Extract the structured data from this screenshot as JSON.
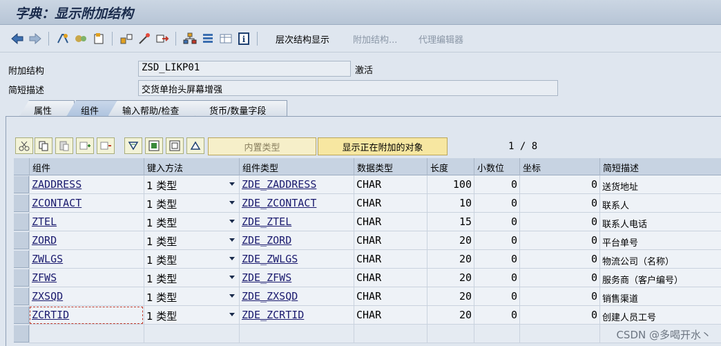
{
  "window": {
    "title": "字典：显示附加结构"
  },
  "toolbar": {
    "hierarchy_label": "层次结构显示",
    "append_label": "附加结构...",
    "proxy_label": "代理编辑器"
  },
  "form": {
    "append_structure_label": "附加结构",
    "append_structure_value": "ZSD_LIKP01",
    "status": "激活",
    "short_desc_label": "简短描述",
    "short_desc_value": "交货单抬头屏幕增强"
  },
  "tabs": [
    {
      "label": "属性"
    },
    {
      "label": "组件"
    },
    {
      "label": "输入帮助/检查"
    },
    {
      "label": "货币/数量字段"
    }
  ],
  "table_toolbar": {
    "builtin_type_label": "内置类型",
    "show_attached_label": "显示正在附加的对象",
    "page": "1 / 8"
  },
  "grid": {
    "headers": [
      "组件",
      "键入方法",
      "组件类型",
      "数据类型",
      "长度",
      "小数位",
      "坐标",
      "简短描述"
    ],
    "rows": [
      {
        "component": "ZADDRESS",
        "method": "1 类型",
        "type": "ZDE_ZADDRESS",
        "datatype": "CHAR",
        "length": "100",
        "decimals": "0",
        "coord": "0",
        "desc": "送货地址"
      },
      {
        "component": "ZCONTACT",
        "method": "1 类型",
        "type": "ZDE_ZCONTACT",
        "datatype": "CHAR",
        "length": "10",
        "decimals": "0",
        "coord": "0",
        "desc": "联系人"
      },
      {
        "component": "ZTEL",
        "method": "1 类型",
        "type": "ZDE_ZTEL",
        "datatype": "CHAR",
        "length": "15",
        "decimals": "0",
        "coord": "0",
        "desc": "联系人电话"
      },
      {
        "component": "ZORD",
        "method": "1 类型",
        "type": "ZDE_ZORD",
        "datatype": "CHAR",
        "length": "20",
        "decimals": "0",
        "coord": "0",
        "desc": "平台单号"
      },
      {
        "component": "ZWLGS",
        "method": "1 类型",
        "type": "ZDE_ZWLGS",
        "datatype": "CHAR",
        "length": "20",
        "decimals": "0",
        "coord": "0",
        "desc": "物流公司（名称）"
      },
      {
        "component": "ZFWS",
        "method": "1 类型",
        "type": "ZDE_ZFWS",
        "datatype": "CHAR",
        "length": "20",
        "decimals": "0",
        "coord": "0",
        "desc": "服务商（客户编号）"
      },
      {
        "component": "ZXSQD",
        "method": "1 类型",
        "type": "ZDE_ZXSQD",
        "datatype": "CHAR",
        "length": "20",
        "decimals": "0",
        "coord": "0",
        "desc": "销售渠道"
      },
      {
        "component": "ZCRTID",
        "method": "1 类型",
        "type": "ZDE_ZCRTID",
        "datatype": "CHAR",
        "length": "20",
        "decimals": "0",
        "coord": "0",
        "desc": "创建人员工号"
      }
    ]
  },
  "watermark": "CSDN @多喝开水丶",
  "colors": {
    "accent_yellow": "#f7e7a1",
    "header_blue": "#c7d3e2",
    "link": "#1a1a6e"
  }
}
